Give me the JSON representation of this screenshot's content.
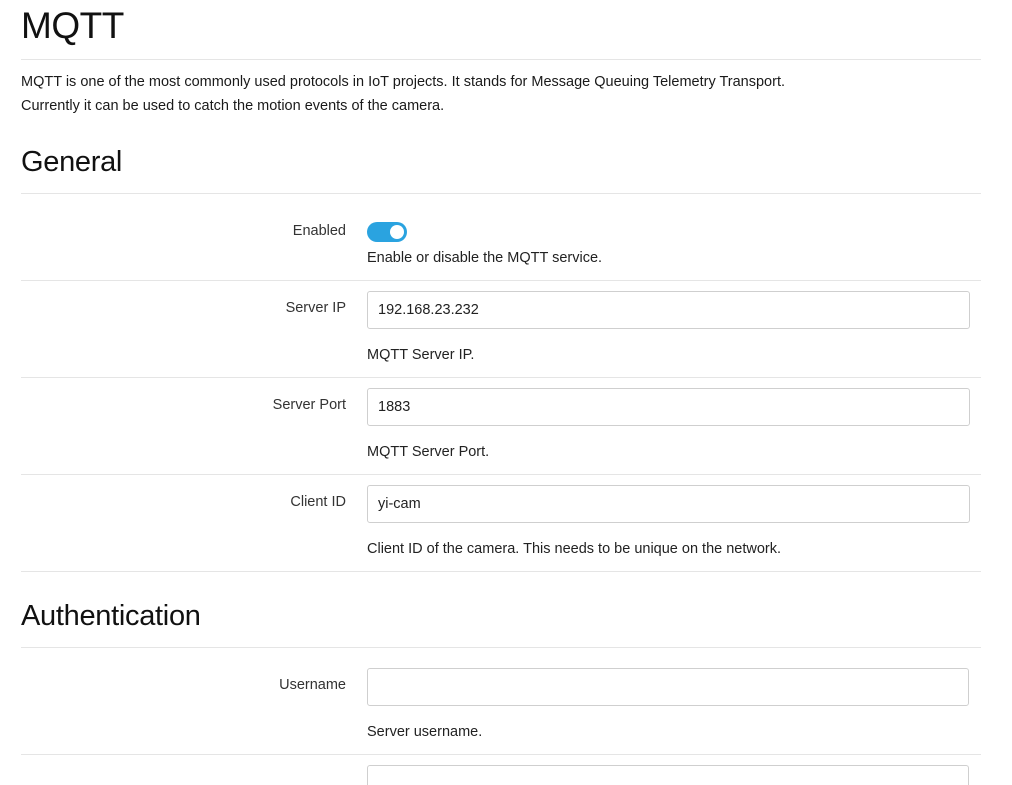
{
  "page": {
    "title": "MQTT",
    "intro_line1": "MQTT is one of the most commonly used protocols in IoT projects. It stands for Message Queuing Telemetry Transport.",
    "intro_line2": "Currently it can be used to catch the motion events of the camera."
  },
  "general": {
    "title": "General",
    "enabled": {
      "label": "Enabled",
      "value": true,
      "help": "Enable or disable the MQTT service."
    },
    "server_ip": {
      "label": "Server IP",
      "value": "192.168.23.232",
      "help": "MQTT Server IP."
    },
    "server_port": {
      "label": "Server Port",
      "value": "1883",
      "help": "MQTT Server Port."
    },
    "client_id": {
      "label": "Client ID",
      "value": "yi-cam",
      "help": "Client ID of the camera. This needs to be unique on the network."
    }
  },
  "authentication": {
    "title": "Authentication",
    "username": {
      "label": "Username",
      "value": "",
      "help": "Server username."
    }
  },
  "colors": {
    "accent": "#2aa3e0",
    "divider": "#e5e5e5",
    "input_border": "#cfcfcf"
  }
}
